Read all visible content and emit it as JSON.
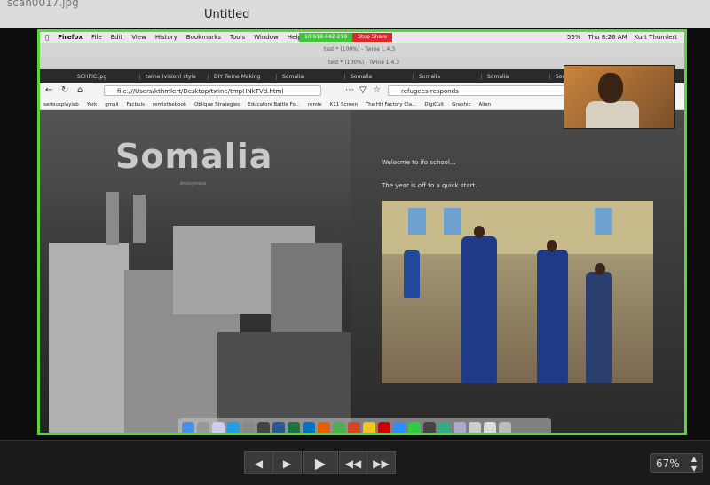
{
  "viewer": {
    "filename": "scan0017.jpg",
    "title": "Untitled",
    "controls": {
      "back": "◀",
      "forward": "▶",
      "play": "▶",
      "skip_back": "◀◀",
      "skip_forward": "▶▶",
      "zoom": "67%"
    }
  },
  "mac_menu": {
    "apple": "",
    "app": "Firefox",
    "items": [
      "File",
      "Edit",
      "View",
      "History",
      "Bookmarks",
      "Tools",
      "Window",
      "Help"
    ],
    "share_id": "10.918-642-219",
    "stop_share": "Stop Share",
    "battery": "55%",
    "clock": "Thu 8:26 AM",
    "user": "Kurt Thumlert"
  },
  "twine_windows": {
    "w1": "test * (100%) - Twine 1.4.3",
    "w2": "test * (100%) - Twine 1.4.3"
  },
  "tabs": [
    "SCHPIC.jpg",
    "twine (vision) style",
    "DIY Twine Making",
    "Somalia",
    "Somalia",
    "Somalia",
    "Somalia",
    "Somalia"
  ],
  "nav": {
    "url": "file:///Users/kthmlert/Desktop/twine/tmpHNkTVd.html",
    "search": "refugees responds"
  },
  "bookmarks": [
    "seriousplaylab",
    "York",
    "gmail",
    "Facbuls",
    "remixthebook",
    "Oblique Strategies",
    "Educators Battle Fo...",
    "remix",
    "K11 Screen",
    "The Hit Factory Cla...",
    "DigiCult",
    "Graphic",
    "Alien"
  ],
  "page": {
    "title": "Somalia",
    "credit": "Anonymous",
    "line1": "Welocme to ifo school...",
    "line2": "The year is off to a quick start."
  },
  "colors": {
    "share_border": "#5bd63a",
    "share_green": "#3fc43a",
    "stop_red": "#e2262a"
  }
}
